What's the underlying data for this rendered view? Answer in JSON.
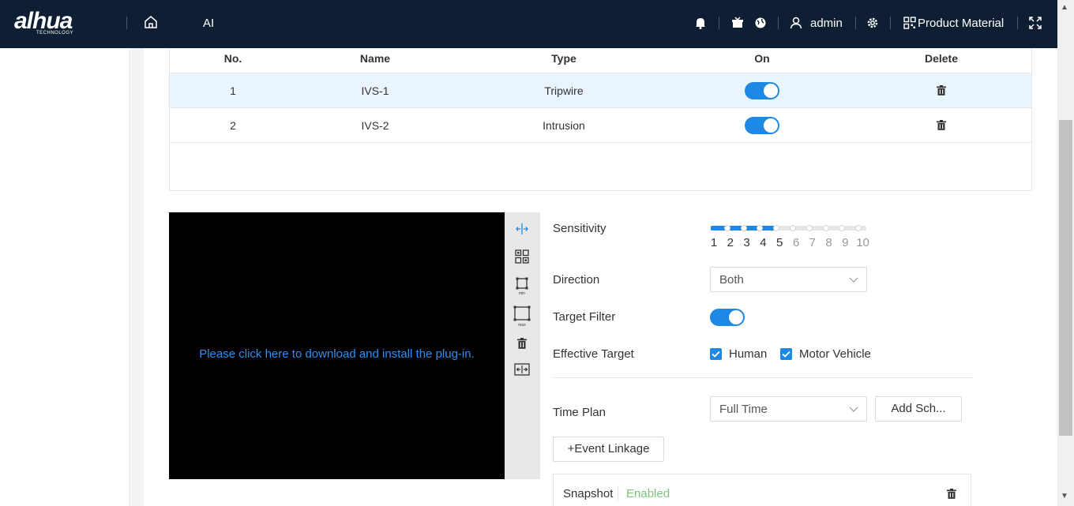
{
  "header": {
    "logo_text": "alhua",
    "logo_subtext": "TECHNOLOGY",
    "nav_ai": "AI",
    "user": "admin",
    "product_material": "Product Material",
    "icons": [
      "home-icon",
      "bell-icon",
      "gift-icon",
      "globe-icon",
      "user-icon",
      "gear-icon",
      "grid-icon",
      "fullscreen-icon"
    ]
  },
  "table": {
    "headers": {
      "no": "No.",
      "name": "Name",
      "type": "Type",
      "on": "On",
      "delete": "Delete"
    },
    "rows": [
      {
        "no": "1",
        "name": "IVS-1",
        "type": "Tripwire",
        "on": true
      },
      {
        "no": "2",
        "name": "IVS-2",
        "type": "Intrusion",
        "on": true
      }
    ]
  },
  "video": {
    "plugin_text": "Please click here to download and install the plug-in."
  },
  "form": {
    "sensitivity_label": "Sensitivity",
    "sensitivity_value": 5,
    "sensitivity_scale": [
      "1",
      "2",
      "3",
      "4",
      "5",
      "6",
      "7",
      "8",
      "9",
      "10"
    ],
    "direction_label": "Direction",
    "direction_value": "Both",
    "target_filter_label": "Target Filter",
    "target_filter_on": true,
    "effective_target_label": "Effective Target",
    "human_label": "Human",
    "motor_vehicle_label": "Motor Vehicle",
    "time_plan_label": "Time Plan",
    "time_plan_value": "Full Time",
    "add_schedule_label": "Add Sch...",
    "event_linkage_label": "+Event Linkage",
    "snapshot_label": "Snapshot",
    "snapshot_status": "Enabled"
  },
  "colors": {
    "accent": "#1e88e5",
    "topbar": "#0e1f33",
    "enabled_green": "#7cc57c",
    "link_blue": "#2e8ff0"
  }
}
